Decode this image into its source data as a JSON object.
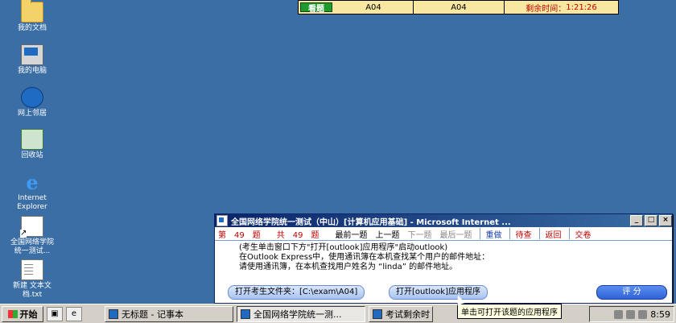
{
  "desktop": {
    "icons": [
      {
        "label": "我的文档",
        "icon": "documents-folder-icon"
      },
      {
        "label": "我的电脑",
        "icon": "my-computer-icon"
      },
      {
        "label": "网上邻居",
        "icon": "network-icon"
      },
      {
        "label": "回收站",
        "icon": "recycle-bin-icon"
      },
      {
        "label_line1": "Internet",
        "label_line2": "Explorer",
        "icon": "ie-icon"
      },
      {
        "label_line1": "全国网络学院",
        "label_line2": "统一测试...",
        "icon": "shortcut-icon"
      },
      {
        "label_line1": "新建 文本文",
        "label_line2": "档.txt",
        "icon": "text-file-icon"
      }
    ]
  },
  "top_bar": {
    "look_label": "看题",
    "field1": "A04",
    "field2": "A04",
    "timer_label": "剩余时间：",
    "timer_value": "1:21:26"
  },
  "exam_window": {
    "title": "全国网络学院统一测试（中山）[计算机应用基础] - Microsoft Internet ...",
    "nav": {
      "current_label": "第",
      "current_num": "49",
      "current_unit": "题",
      "total_label": "共",
      "total_num": "49",
      "total_unit": "题",
      "first": "最前一题",
      "prev": "上一题",
      "next": "下一题",
      "last": "最后一题",
      "redo": "重做",
      "review": "待查",
      "back": "返回",
      "submit": "交卷"
    },
    "question": {
      "line1": "(考生单击窗口下方\"打开[outlook]应用程序\"启动outlook)",
      "line2": "在Outlook Express中，使用通讯簿在本机查找某个用户的邮件地址：",
      "line3": "请使用通讯簿，在本机查找用户姓名为 “linda” 的邮件地址。"
    },
    "buttons": {
      "open_folder": "打开考生文件夹：[C:\\exam\\A04]",
      "open_outlook": "打开[outlook]应用程序",
      "score": "评 分"
    }
  },
  "tooltip": "单击可打开该题的应用程序",
  "taskbar": {
    "start": "开始",
    "tasks": [
      {
        "label": "无标题 - 记事本",
        "active": false
      },
      {
        "label": "全国网络学院统一测...",
        "active": true
      },
      {
        "label": "考试剩余时",
        "active": false
      }
    ],
    "clock": "8:59"
  }
}
